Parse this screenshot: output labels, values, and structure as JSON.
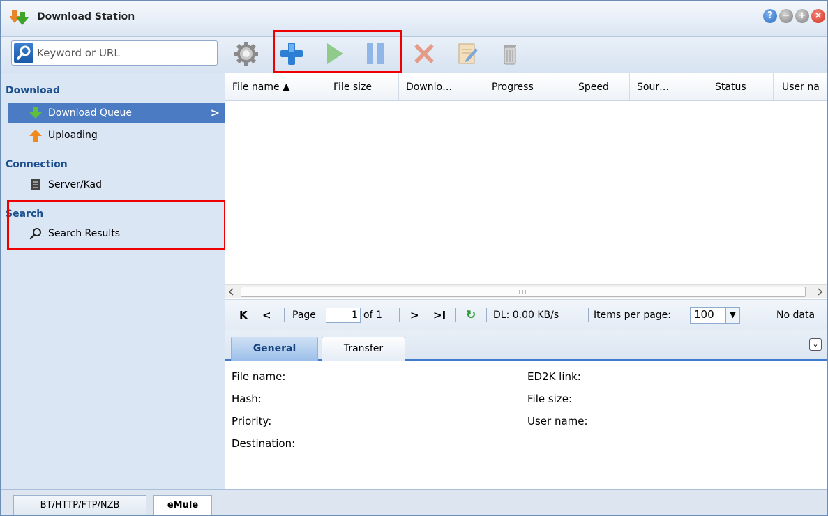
{
  "app": {
    "title": "Download Station"
  },
  "window_buttons": [
    "help-icon",
    "minimize-icon",
    "maximize-icon",
    "close-icon"
  ],
  "search": {
    "placeholder": "Keyword or URL"
  },
  "toolbar": {
    "buttons": [
      "gear-icon",
      "add-icon",
      "play-icon",
      "pause-icon",
      "delete-icon",
      "edit-icon",
      "clear-icon"
    ]
  },
  "sidebar": {
    "sections": [
      {
        "title": "Download",
        "items": [
          {
            "label": "Download Queue",
            "selected": true
          },
          {
            "label": "Uploading"
          }
        ]
      },
      {
        "title": "Connection",
        "items": [
          {
            "label": "Server/Kad"
          }
        ]
      },
      {
        "title": "Search",
        "items": [
          {
            "label": "Search Results"
          }
        ]
      }
    ]
  },
  "grid": {
    "columns": [
      "File name ▲",
      "File size",
      "Downlo…",
      "Progress",
      "Speed",
      "Sour…",
      "Status",
      "User na"
    ]
  },
  "pager": {
    "page_label": "Page",
    "page_value": "1",
    "of_label": "of 1",
    "dl_label": "DL: 0.00 KB/s",
    "ipp_label": "Items per page:",
    "ipp_value": "100",
    "status": "No data"
  },
  "detail": {
    "tabs": [
      "General",
      "Transfer"
    ],
    "left_labels": [
      "File name:",
      "Hash:",
      "Priority:",
      "Destination:"
    ],
    "right_labels": [
      "ED2K link:",
      "File size:",
      "User name:"
    ]
  },
  "bottom_tabs": [
    "BT/HTTP/FTP/NZB",
    "eMule"
  ],
  "colors": {
    "accent": "#4b7bc2",
    "highlight_box": "#e00000",
    "sidebar_bg": "#dae6f4"
  }
}
